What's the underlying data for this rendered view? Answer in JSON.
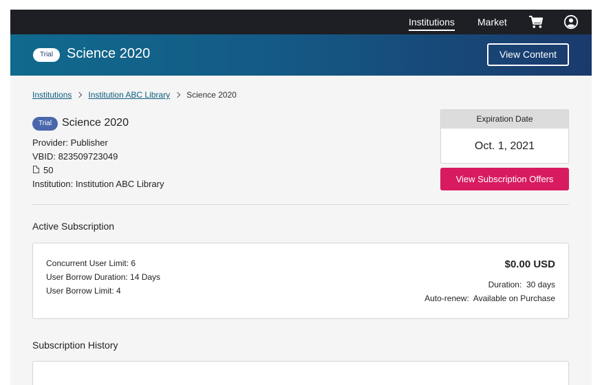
{
  "nav": {
    "institutions": "Institutions",
    "market": "Market",
    "cart_icon": "cart-icon",
    "account_icon": "account-icon"
  },
  "banner": {
    "badge": "Trial",
    "title": "Science 2020",
    "view_content": "View Content"
  },
  "breadcrumb": {
    "items": [
      "Institutions",
      "Institution ABC Library",
      "Science 2020"
    ]
  },
  "book": {
    "badge": "Trial",
    "title": "Science 2020",
    "provider": "Provider: Publisher",
    "vbid": "VBID: 823509723049",
    "pages": "50",
    "institution": "Institution: Institution ABC Library"
  },
  "expiration": {
    "label": "Expiration Date",
    "value": "Oct. 1, 2021"
  },
  "offers_button": "View Subscription Offers",
  "active_subscription": {
    "title": "Active Subscription",
    "concurrent": "Concurrent User Limit: 6",
    "borrow_duration": "User Borrow Duration: 14 Days",
    "borrow_limit": "User Borrow Limit: 4",
    "price": "$0.00 USD",
    "duration": "Duration:  30 days",
    "auto_renew": "Auto-renew:  Available on Purchase"
  },
  "history": {
    "title": "Subscription History"
  },
  "colors": {
    "nav_bg": "#1d1f25",
    "banner_start": "#106a8d",
    "banner_end": "#1a3a6c",
    "accent_pink": "#d81b60",
    "badge_blue": "#4a67ac",
    "link": "#0c5c7e"
  }
}
